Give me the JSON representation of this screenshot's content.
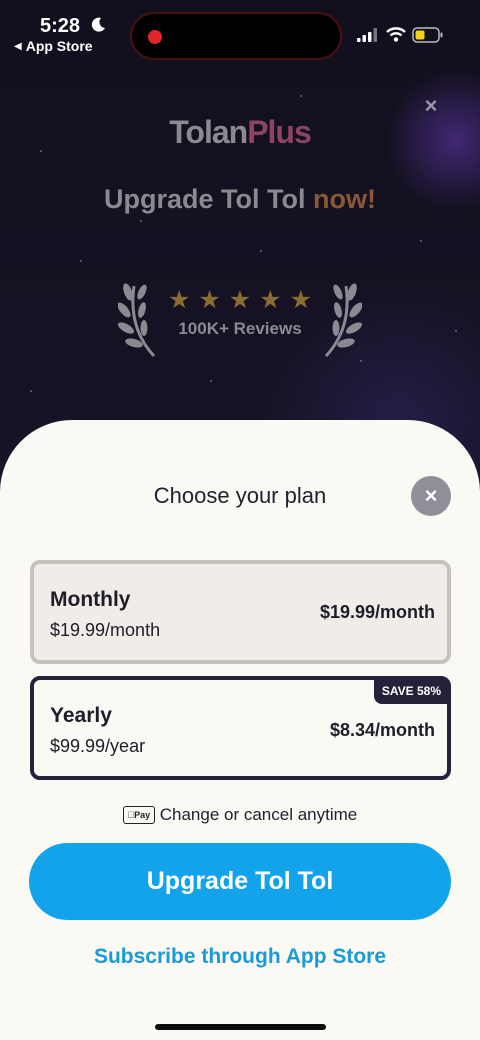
{
  "status_bar": {
    "time": "5:28",
    "back_label": "App Store",
    "icons": [
      "moon-icon",
      "signal-icon",
      "wifi-icon",
      "battery-icon"
    ]
  },
  "background": {
    "brand_part1": "Tolan",
    "brand_part2": "Plus",
    "headline_main": "Upgrade Tol Tol",
    "headline_accent": "now!",
    "star_glyph": "★",
    "star_count": 5,
    "reviews": "100K+ Reviews"
  },
  "sheet": {
    "title": "Choose your plan",
    "close_glyph": "×",
    "plans": [
      {
        "name": "Monthly",
        "sub": "$19.99/month",
        "price": "$19.99/month",
        "selected": false
      },
      {
        "name": "Yearly",
        "sub": "$99.99/year",
        "price": "$8.34/month",
        "badge": "SAVE 58%",
        "selected": true
      }
    ],
    "applepay_label": "Pay",
    "cancel_text": "Change or cancel anytime",
    "upgrade_label": "Upgrade Tol Tol",
    "subscribe_label": "Subscribe through App Store"
  },
  "colors": {
    "accent_blue": "#12a3ea",
    "link_blue": "#1a9bd8",
    "selected_border": "#24223a",
    "sheet_bg": "#fbf9f4"
  }
}
